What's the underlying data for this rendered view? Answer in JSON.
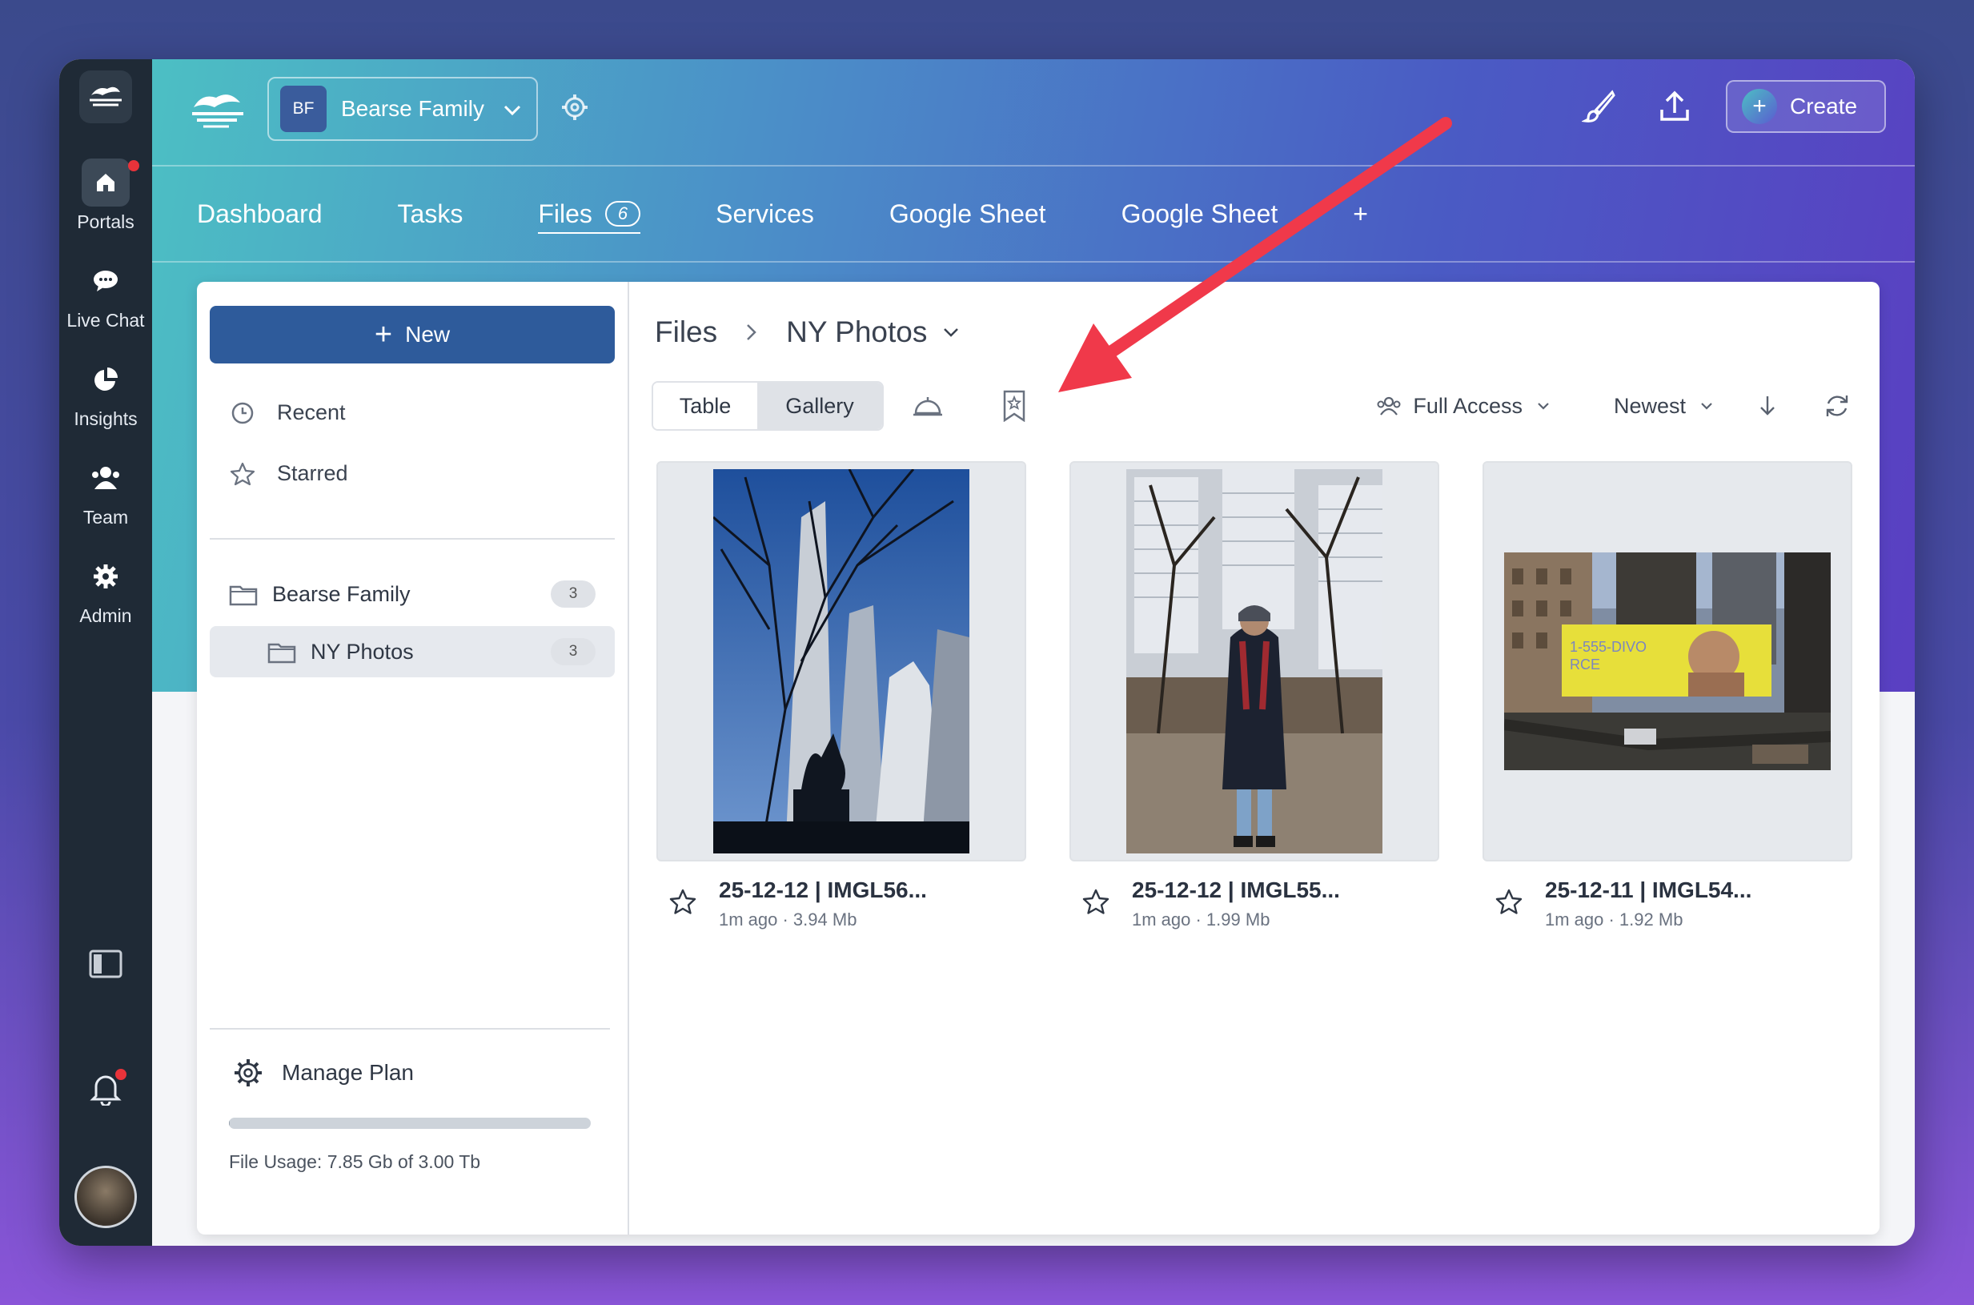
{
  "rail": {
    "items": [
      {
        "label": "Portals",
        "icon": "home-icon",
        "active": true,
        "notification": true
      },
      {
        "label": "Live Chat",
        "icon": "chat-bubble-icon"
      },
      {
        "label": "Insights",
        "icon": "pie-chart-icon"
      },
      {
        "label": "Team",
        "icon": "team-icon"
      },
      {
        "label": "Admin",
        "icon": "gear-icon"
      }
    ]
  },
  "header": {
    "portal": {
      "initials": "BF",
      "name": "Bearse Family"
    },
    "create_label": "Create",
    "tabs": [
      {
        "label": "Dashboard"
      },
      {
        "label": "Tasks"
      },
      {
        "label": "Files",
        "count": "6",
        "active": true
      },
      {
        "label": "Services"
      },
      {
        "label": "Google Sheet"
      },
      {
        "label": "Google Sheet"
      }
    ],
    "add_tab": "+"
  },
  "sidebar": {
    "new_label": "New",
    "nav": [
      {
        "label": "Recent",
        "icon": "clock-icon"
      },
      {
        "label": "Starred",
        "icon": "star-icon"
      }
    ],
    "folders": [
      {
        "label": "Bearse Family",
        "count": "3"
      },
      {
        "label": "NY Photos",
        "count": "3",
        "selected": true
      }
    ],
    "manage_plan": "Manage Plan",
    "usage_text": "File Usage: 7.85 Gb of 3.00 Tb",
    "usage_fraction": 0.003
  },
  "content": {
    "breadcrumb": {
      "root": "Files",
      "current": "NY Photos"
    },
    "view": {
      "table": "Table",
      "gallery": "Gallery",
      "selected": "Gallery"
    },
    "access_label": "Full Access",
    "sort_label": "Newest",
    "files": [
      {
        "name": "25-12-12 | IMGL56...",
        "meta": "1m ago · 3.94 Mb"
      },
      {
        "name": "25-12-12 | IMGL55...",
        "meta": "1m ago · 1.99 Mb"
      },
      {
        "name": "25-12-11 | IMGL54...",
        "meta": "1m ago · 1.92 Mb"
      }
    ],
    "billboard_text_1": "1-555-DIVO",
    "billboard_text_2": "RCE"
  },
  "colors": {
    "rail_bg": "#1f2a36",
    "primary": "#2e5b9b",
    "annotation_arrow": "#f0394a",
    "notification": "#e8333a"
  }
}
